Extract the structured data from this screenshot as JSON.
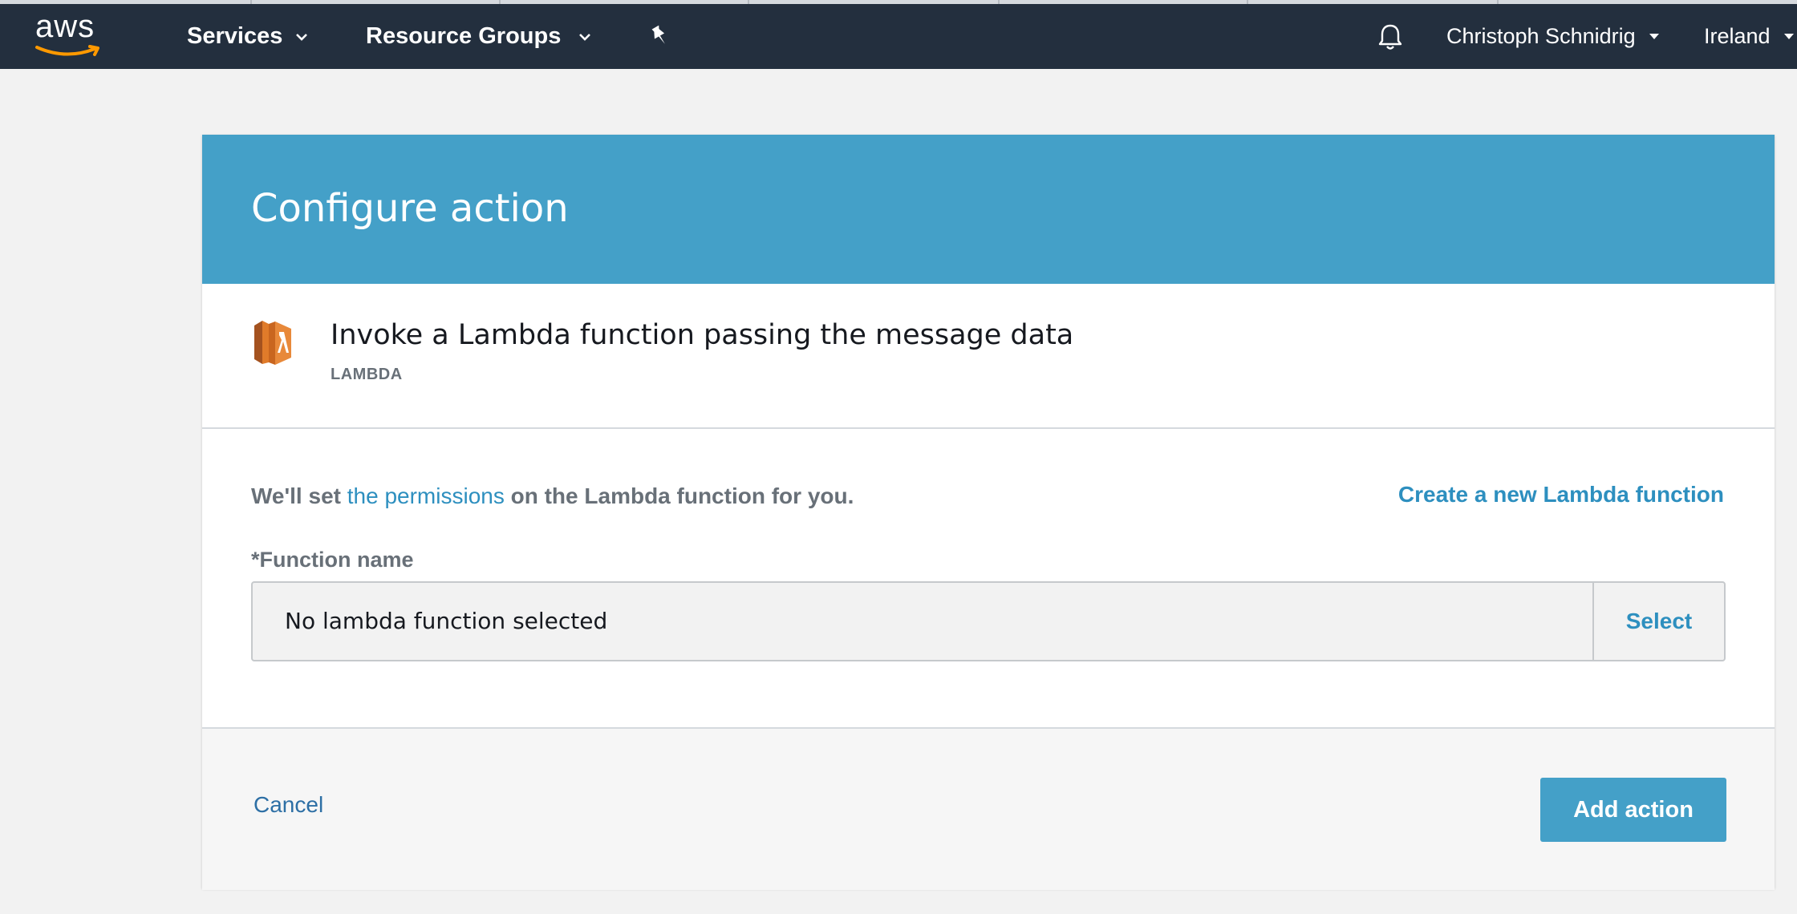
{
  "topnav": {
    "logo_text": "aws",
    "services_label": "Services",
    "resource_groups_label": "Resource Groups",
    "user_label": "Christoph Schnidrig",
    "region_label": "Ireland"
  },
  "modal": {
    "title": "Configure action",
    "action": {
      "title": "Invoke a Lambda function passing the message data",
      "subtitle": "LAMBDA",
      "icon": "lambda-icon"
    },
    "permissions": {
      "prefix": "We'll set ",
      "link": "the permissions",
      "suffix": " on the Lambda function for you."
    },
    "create_link": "Create a new Lambda function",
    "function_name": {
      "label": "*Function name",
      "value": "No lambda function selected",
      "select_label": "Select"
    },
    "footer": {
      "cancel_label": "Cancel",
      "add_label": "Add action"
    }
  },
  "colors": {
    "nav_bg": "#232f3e",
    "header_bg": "#44a0c8",
    "link": "#2d8fbf",
    "lambda_orange": "#e07b2a"
  }
}
